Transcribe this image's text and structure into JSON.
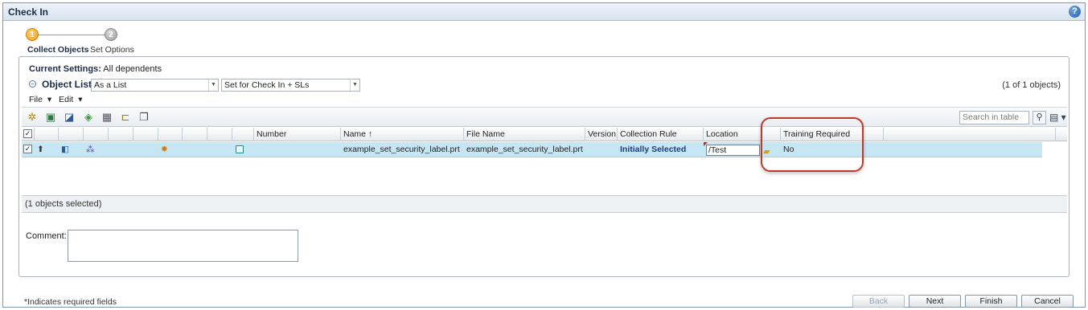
{
  "window": {
    "title": "Check In",
    "help_icon": "help-icon"
  },
  "wizard": {
    "steps": [
      {
        "number": "1",
        "label": "Collect Objects"
      },
      {
        "number": "2",
        "label": "Set Options"
      }
    ]
  },
  "settings": {
    "label": "Current Settings:",
    "value": "All dependents"
  },
  "object_list": {
    "title": "Object List",
    "view_select": "As a List",
    "filter_select": "Set for Check In + SLs",
    "count": "(1 of 1 objects)"
  },
  "menus": {
    "file": "File",
    "edit": "Edit"
  },
  "toolbar": {
    "search_placeholder": "Search in table"
  },
  "table": {
    "columns": [
      "Number",
      "Name ↑",
      "File Name",
      "Version",
      "Collection Rule",
      "Location",
      "Training Required"
    ],
    "rows": [
      {
        "number": "",
        "name": "example_set_security_label.prt",
        "file_name": "example_set_security_label.prt",
        "version": "",
        "collection_rule": "Initially Selected",
        "location": "/Test",
        "training_required": "No"
      }
    ],
    "selected_summary": "(1 objects selected)"
  },
  "comment": {
    "label": "Comment:",
    "value": ""
  },
  "footer": {
    "note": "*Indicates required fields",
    "buttons": {
      "back": "Back",
      "next": "Next",
      "finish": "Finish",
      "cancel": "Cancel"
    }
  },
  "colors": {
    "selected_row": "#c6e6f4",
    "highlight": "#c0392b",
    "collection_rule_text": "#1a3f7a"
  }
}
